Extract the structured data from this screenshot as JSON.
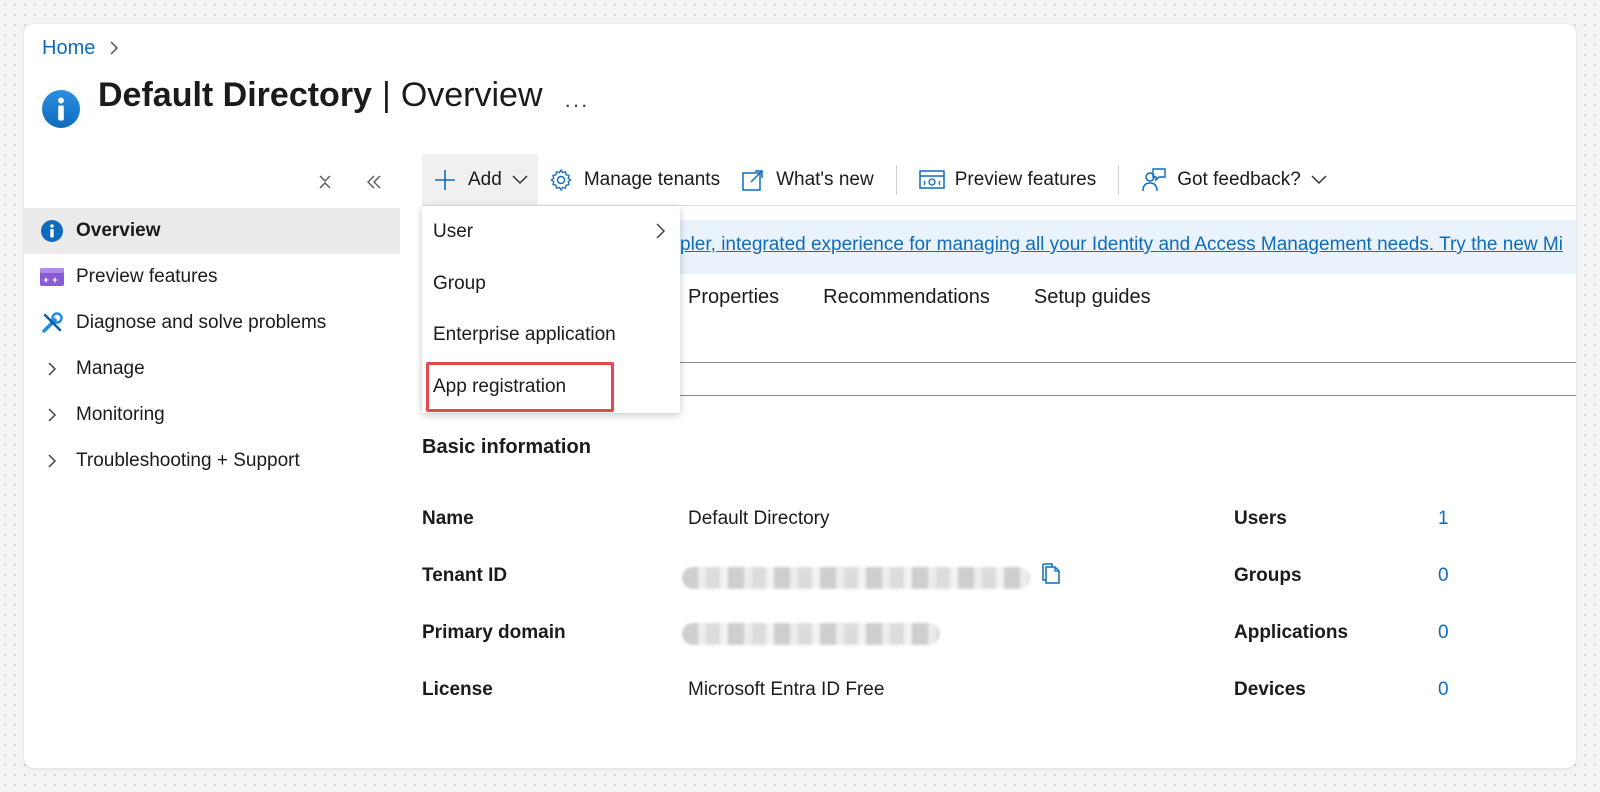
{
  "breadcrumb": {
    "home": "Home"
  },
  "header": {
    "title_bold": "Default Directory",
    "separator": "|",
    "title_rest": "Overview",
    "more": "···"
  },
  "sidebar": {
    "items": [
      {
        "label": "Overview",
        "icon": "info-icon"
      },
      {
        "label": "Preview features",
        "icon": "preview-features-icon"
      },
      {
        "label": "Diagnose and solve problems",
        "icon": "wrench-icon"
      },
      {
        "label": "Manage",
        "icon": "chevron-right-icon"
      },
      {
        "label": "Monitoring",
        "icon": "chevron-right-icon"
      },
      {
        "label": "Troubleshooting + Support",
        "icon": "chevron-right-icon"
      }
    ]
  },
  "toolbar": {
    "add": "Add",
    "manage_tenants": "Manage tenants",
    "whats_new": "What's new",
    "preview_features": "Preview features",
    "feedback": "Got feedback?"
  },
  "banner": {
    "text": "pler, integrated experience for managing all your Identity and Access Management needs. Try the new Mi"
  },
  "tabs": [
    "Properties",
    "Recommendations",
    "Setup guides"
  ],
  "dropdown": {
    "items": [
      "User",
      "Group",
      "Enterprise application",
      "App registration"
    ],
    "highlighted": "App registration"
  },
  "basic_info": {
    "title": "Basic information",
    "fields": [
      {
        "label": "Name",
        "value": "Default Directory"
      },
      {
        "label": "Tenant ID",
        "value": ""
      },
      {
        "label": "Primary domain",
        "value": ""
      },
      {
        "label": "License",
        "value": "Microsoft Entra ID Free"
      }
    ],
    "stats": [
      {
        "label": "Users",
        "value": "1"
      },
      {
        "label": "Groups",
        "value": "0"
      },
      {
        "label": "Applications",
        "value": "0"
      },
      {
        "label": "Devices",
        "value": "0"
      }
    ]
  },
  "colors": {
    "accent": "#0f6cbd",
    "highlight": "#e5484d",
    "banner_bg": "#eaf3fc",
    "active_nav_bg": "#ebebeb"
  }
}
